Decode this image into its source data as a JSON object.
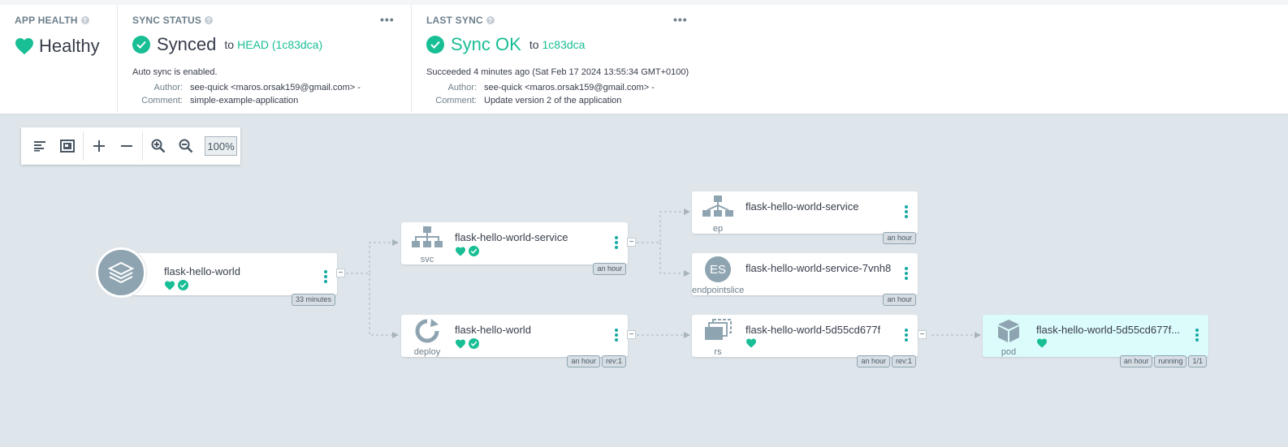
{
  "app_health": {
    "title": "APP HEALTH",
    "status": "Healthy"
  },
  "sync_status": {
    "title": "SYNC STATUS",
    "status": "Synced",
    "to_label": "to",
    "revision": "HEAD (1c83dca)",
    "auto_sync": "Auto sync is enabled.",
    "author_label": "Author:",
    "author": "see-quick <maros.orsak159@gmail.com> -",
    "comment_label": "Comment:",
    "comment": "simple-example-application"
  },
  "last_sync": {
    "title": "LAST SYNC",
    "status": "Sync OK",
    "to_label": "to",
    "revision": "1c83dca",
    "succeeded": "Succeeded 4 minutes ago (Sat Feb 17 2024 13:55:34 GMT+0100)",
    "author_label": "Author:",
    "author": "see-quick <maros.orsak159@gmail.com> -",
    "comment_label": "Comment:",
    "comment": "Update version 2 of the application"
  },
  "toolbar": {
    "zoom": "100%"
  },
  "graph": {
    "app": {
      "name": "flask-hello-world",
      "tags": [
        "33 minutes"
      ]
    },
    "svc": {
      "name": "flask-hello-world-service",
      "kind": "svc",
      "tags": [
        "an hour"
      ]
    },
    "deploy": {
      "name": "flask-hello-world",
      "kind": "deploy",
      "tags": [
        "an hour",
        "rev:1"
      ]
    },
    "ep": {
      "name": "flask-hello-world-service",
      "kind": "ep",
      "tags": [
        "an hour"
      ]
    },
    "endpointslice": {
      "name": "flask-hello-world-service-7vnh8",
      "kind": "endpointslice",
      "icon_text": "ES",
      "tags": [
        "an hour"
      ]
    },
    "rs": {
      "name": "flask-hello-world-5d55cd677f",
      "kind": "rs",
      "tags": [
        "an hour",
        "rev:1"
      ]
    },
    "pod": {
      "name": "flask-hello-world-5d55cd677f...",
      "kind": "pod",
      "tags": [
        "an hour",
        "running",
        "1/1"
      ]
    }
  },
  "colors": {
    "healthy": "#18be94",
    "synced": "#18be94",
    "accent": "#15a9a1",
    "icon_gray": "#8fa4b1",
    "background": "#dee6eb"
  }
}
